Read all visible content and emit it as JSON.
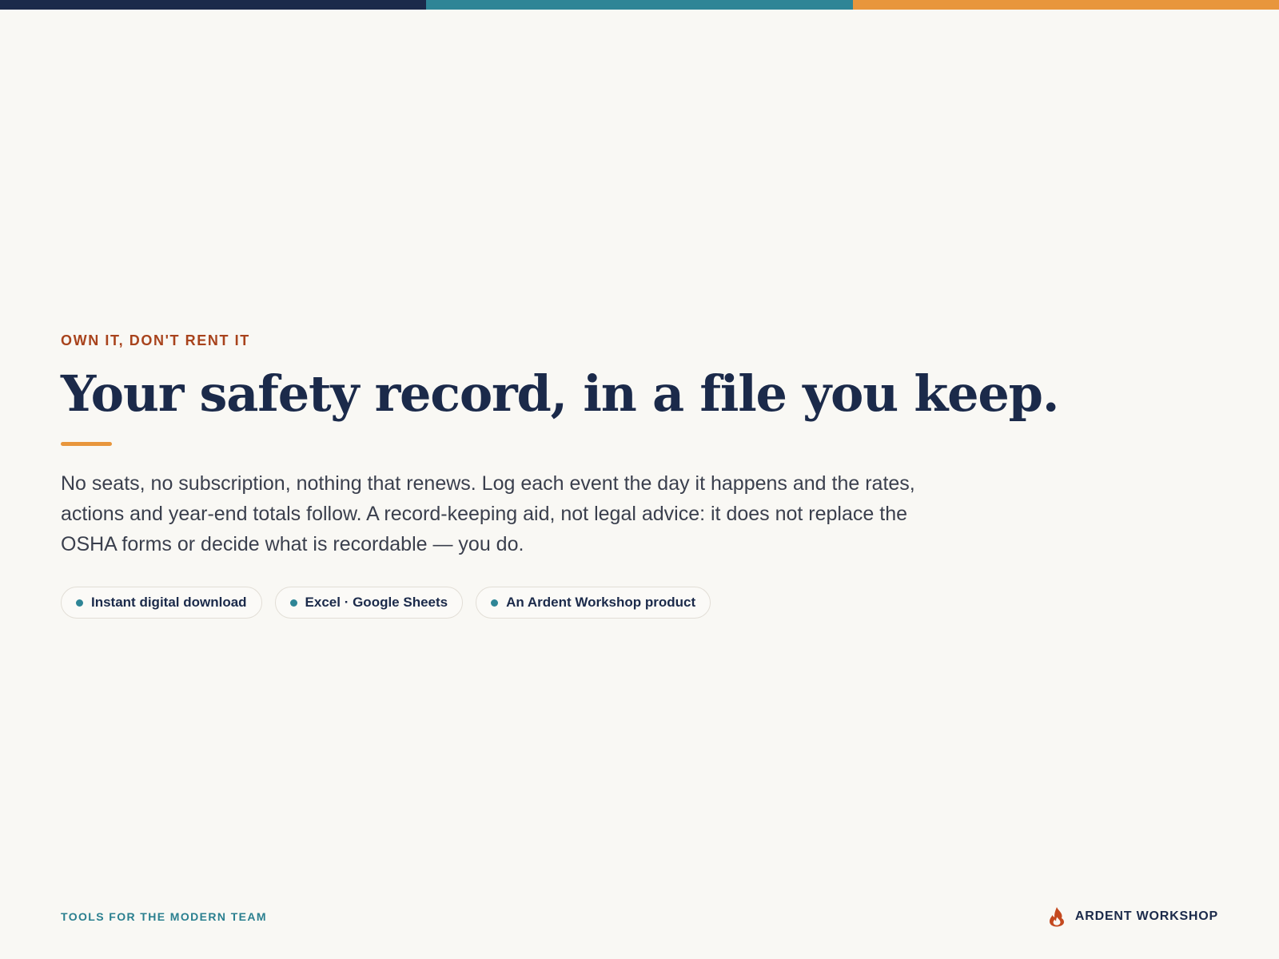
{
  "colors": {
    "stripe": [
      "#1b2a4a",
      "#2e8596",
      "#e8963c"
    ],
    "accent_rule": "#e8963c",
    "chip_dot": "#2e8596",
    "eyebrow": "#a8431c",
    "brand_icon": "#c4491f"
  },
  "hero": {
    "eyebrow": "OWN IT, DON'T RENT IT",
    "headline": "Your safety record, in a file you keep.",
    "lede": "No seats, no subscription, nothing that renews. Log each event the day it happens and the rates, actions and year-end totals follow. A record-keeping aid, not legal advice: it does not replace the OSHA forms or decide what is recordable — you do.",
    "chips": [
      {
        "label": "Instant digital download"
      },
      {
        "label": "Excel · Google Sheets"
      },
      {
        "label": "An Ardent Workshop product"
      }
    ]
  },
  "footer": {
    "tagline": "TOOLS FOR THE MODERN TEAM",
    "brand_icon": "flame-icon",
    "brand_name": "ARDENT WORKSHOP"
  }
}
